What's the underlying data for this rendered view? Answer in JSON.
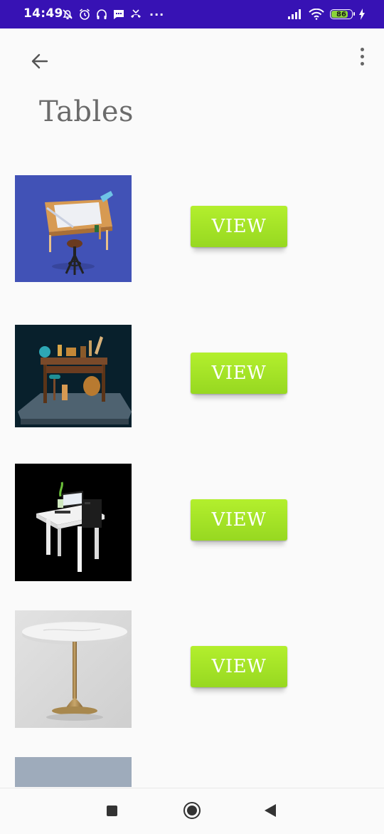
{
  "status_bar": {
    "time": "14:49",
    "icons_left": [
      "muted-notification-icon",
      "alarm-icon",
      "headphones-icon",
      "message-icon",
      "missed-call-icon",
      "more-notifications-icon"
    ],
    "more_glyph": "···",
    "battery_level": "86",
    "bg_color": "#3712b4"
  },
  "toolbar": {
    "back_icon": "arrow-left-icon",
    "menu_icon": "more-vertical-icon"
  },
  "page": {
    "title": "Tables"
  },
  "items": [
    {
      "name": "drafting-table-image",
      "button_label": "VIEW"
    },
    {
      "name": "workshop-table-image",
      "button_label": "VIEW"
    },
    {
      "name": "computer-desk-image",
      "button_label": "VIEW"
    },
    {
      "name": "marble-round-table-image",
      "button_label": "VIEW"
    }
  ],
  "accent_color": "#a6e32a",
  "nav_bar": {
    "icons": [
      "recent-apps-icon",
      "home-icon",
      "back-triangle-icon"
    ]
  }
}
